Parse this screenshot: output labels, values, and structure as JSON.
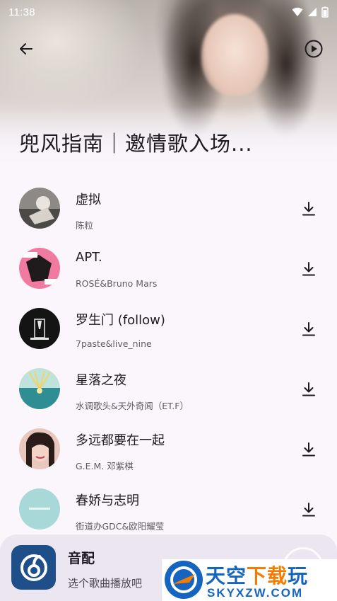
{
  "status_bar": {
    "time": "11:38"
  },
  "header": {
    "playlist_title": "兜风指南｜邀情歌入场..."
  },
  "songs": [
    {
      "title": "虚拟",
      "artist": "陈粒"
    },
    {
      "title": "APT.",
      "artist": "ROSÉ&Bruno Mars"
    },
    {
      "title": "罗生门 (follow)",
      "artist": "7paste&live_nine"
    },
    {
      "title": "星落之夜",
      "artist": "水调歌头&天外奇闻（ET.F）"
    },
    {
      "title": "多远都要在一起",
      "artist": "G.E.M. 邓紫棋"
    },
    {
      "title": "春娇与志明",
      "artist": "街道办GDC&欧阳耀莹"
    }
  ],
  "mini_player": {
    "title": "音配",
    "subtitle": "选个歌曲播放吧"
  },
  "watermark": {
    "name_part1": "天空",
    "name_part2": "下载",
    "name_part3": "玩",
    "url": "SKYXZW.COM"
  },
  "colors": {
    "accent_blue": "#1e4f88",
    "watermark_blue": "#1565c0",
    "watermark_orange": "#f57c00",
    "player_bg": "#ece6f0"
  }
}
